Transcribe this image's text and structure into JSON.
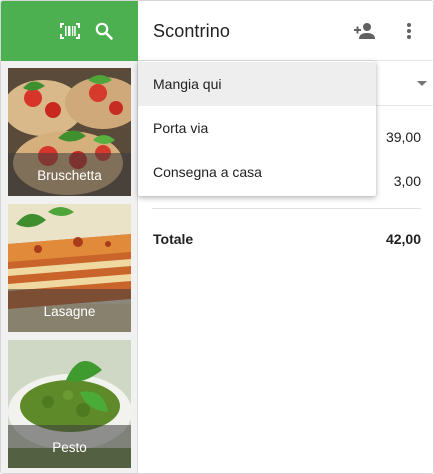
{
  "header": {
    "title": "Scontrino"
  },
  "toolbar_icons": {
    "barcode": "barcode-icon",
    "search": "search-icon",
    "add_customer": "person-add-icon",
    "more": "more-vert-icon"
  },
  "products": [
    {
      "label": "Bruschetta"
    },
    {
      "label": "Lasagne"
    },
    {
      "label": "Pesto"
    }
  ],
  "order_mode": {
    "options": [
      "Mangia qui",
      "Porta via",
      "Consegna a casa"
    ]
  },
  "receipt": {
    "lines": [
      {
        "amount": "39,00"
      },
      {
        "amount": "3,00"
      }
    ],
    "total_label": "Totale",
    "total_value": "42,00"
  },
  "colors": {
    "accent": "#4caf50",
    "menu_highlight": "#eeeeee"
  }
}
